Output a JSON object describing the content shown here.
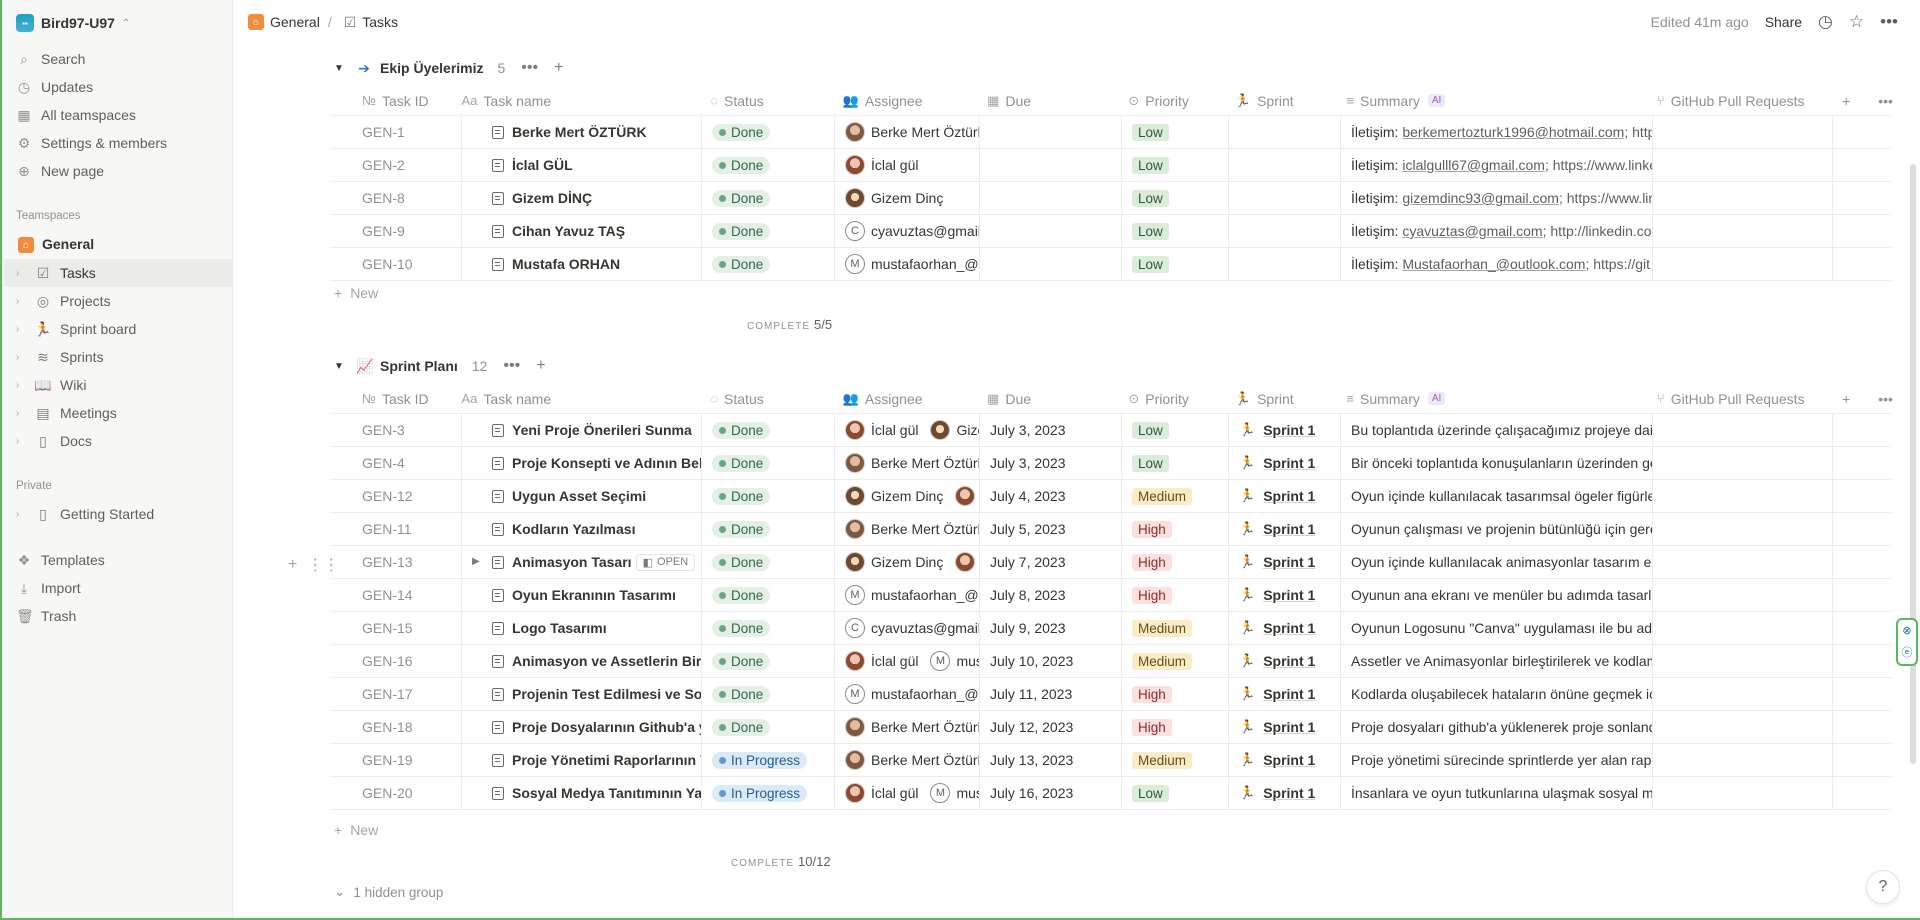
{
  "workspace": {
    "name": "Bird97-U97"
  },
  "sidebar": {
    "nav": [
      {
        "label": "Search",
        "icon": "search-icon"
      },
      {
        "label": "Updates",
        "icon": "clock-icon"
      },
      {
        "label": "All teamspaces",
        "icon": "grid-icon"
      },
      {
        "label": "Settings & members",
        "icon": "gear-icon"
      },
      {
        "label": "New page",
        "icon": "plus-circle-icon"
      }
    ],
    "teamspaces_label": "Teamspaces",
    "teamspace_home": "General",
    "teamspace_items": [
      {
        "label": "Tasks",
        "icon": "checkbox-icon"
      },
      {
        "label": "Projects",
        "icon": "target-icon"
      },
      {
        "label": "Sprint board",
        "icon": "runner-icon"
      },
      {
        "label": "Sprints",
        "icon": "database-icon"
      },
      {
        "label": "Wiki",
        "icon": "book-icon"
      },
      {
        "label": "Meetings",
        "icon": "calendar-icon"
      },
      {
        "label": "Docs",
        "icon": "document-icon"
      }
    ],
    "private_label": "Private",
    "private_items": [
      {
        "label": "Getting Started"
      }
    ],
    "bottom": [
      {
        "label": "Templates",
        "icon": "templates-icon"
      },
      {
        "label": "Import",
        "icon": "import-icon"
      },
      {
        "label": "Trash",
        "icon": "trash-icon"
      }
    ]
  },
  "topbar": {
    "crumb1": "General",
    "crumb_sep": "/",
    "crumb2": "Tasks",
    "edited": "Edited 41m ago",
    "share": "Share"
  },
  "columns": {
    "id": "Task ID",
    "name": "Task name",
    "status": "Status",
    "assignee": "Assignee",
    "due": "Due",
    "priority": "Priority",
    "sprint": "Sprint",
    "summary": "Summary",
    "ai": "AI",
    "github": "GitHub Pull Requests"
  },
  "group1": {
    "title": "Ekip Üyelerimiz",
    "count": "5",
    "new_label": "New",
    "complete_label": "COMPLETE",
    "complete_value": "5/5",
    "rows": [
      {
        "id": "GEN-1",
        "name": "Berke Mert ÖZTÜRK",
        "status": "Done",
        "assignee": "Berke Mert Öztürk",
        "priority": "Low",
        "summary_prefix": "İletişim: ",
        "summary_link": "berkemertozturk1996@hotmail.com",
        "summary_rest": "; http"
      },
      {
        "id": "GEN-2",
        "name": "İclal GÜL",
        "status": "Done",
        "assignee": "İclal gül",
        "priority": "Low",
        "summary_prefix": "İletişim: ",
        "summary_link": "iclalgulll67@gmail.com",
        "summary_rest": "; https://www.linke"
      },
      {
        "id": "GEN-8",
        "name": "Gizem DİNÇ",
        "status": "Done",
        "assignee": "Gizem Dinç",
        "priority": "Low",
        "summary_prefix": "İletişim: ",
        "summary_link": "gizemdinc93@gmail.com",
        "summary_rest": "; https://www.lir"
      },
      {
        "id": "GEN-9",
        "name": "Cihan Yavuz TAŞ",
        "status": "Done",
        "assignee": "cyavuztas@gmail.",
        "priority": "Low",
        "summary_prefix": "İletişim: ",
        "summary_link": "cyavuztas@gmail.com",
        "summary_rest": "; http://linkedin.cor"
      },
      {
        "id": "GEN-10",
        "name": "Mustafa ORHAN",
        "status": "Done",
        "assignee": "mustafaorhan_@o",
        "priority": "Low",
        "summary_prefix": "İletişim: ",
        "summary_link": "Mustafaorhan_@outlook.com",
        "summary_rest": "; https://git"
      }
    ]
  },
  "group2": {
    "title": "Sprint Planı",
    "count": "12",
    "new_label": "New",
    "complete_label": "COMPLETE",
    "complete_value": "10/12",
    "open_label": "OPEN",
    "rows": [
      {
        "id": "GEN-3",
        "name": "Yeni Proje Önerileri Sunma",
        "status": "Done",
        "a1": "İclal gül",
        "a2": "Gize",
        "due": "July 3, 2023",
        "priority": "Low",
        "sprint": "Sprint 1",
        "summary": "Bu toplantıda üzerinde çalışacağımız projeye dair"
      },
      {
        "id": "GEN-4",
        "name": "Proje Konsepti ve Adının Bel",
        "status": "Done",
        "a1": "Berke Mert Öztürk",
        "a2": "",
        "due": "July 3, 2023",
        "priority": "Low",
        "sprint": "Sprint 1",
        "summary": "Bir önceki toplantıda konuşulanların üzerinden ge"
      },
      {
        "id": "GEN-12",
        "name": "Uygun Asset Seçimi",
        "status": "Done",
        "a1": "Gizem Dinç",
        "a2": "İ",
        "due": "July 4, 2023",
        "priority": "Medium",
        "sprint": "Sprint 1",
        "summary": "Oyun içinde kullanılacak tasarımsal ögeler figürle"
      },
      {
        "id": "GEN-11",
        "name": "Kodların Yazılması",
        "status": "Done",
        "a1": "Berke Mert Öztürk",
        "a2": "",
        "due": "July 5, 2023",
        "priority": "High",
        "sprint": "Sprint 1",
        "summary": "Oyunun çalışması ve projenin bütünlüğü için gere"
      },
      {
        "id": "GEN-13",
        "name": "Animasyon Tasarı",
        "status": "Done",
        "a1": "Gizem Dinç",
        "a2": "İ",
        "due": "July 7, 2023",
        "priority": "High",
        "sprint": "Sprint 1",
        "summary": "Oyun içinde kullanılacak animasyonlar tasarım eki"
      },
      {
        "id": "GEN-14",
        "name": "Oyun Ekranının Tasarımı",
        "status": "Done",
        "a1": "mustafaorhan_@o",
        "a2": "",
        "due": "July 8, 2023",
        "priority": "High",
        "sprint": "Sprint 1",
        "summary": "Oyunun ana ekranı ve menüler bu adımda tasarla"
      },
      {
        "id": "GEN-15",
        "name": "Logo Tasarımı",
        "status": "Done",
        "a1": "cyavuztas@gmail.",
        "a2": "",
        "due": "July 9, 2023",
        "priority": "Medium",
        "sprint": "Sprint 1",
        "summary": "Oyunun Logosunu \"Canva\" uygulaması ile bu adır"
      },
      {
        "id": "GEN-16",
        "name": "Animasyon ve Assetlerin Birl",
        "status": "Done",
        "a1": "İclal gül",
        "a2": "mus",
        "due": "July 10, 2023",
        "priority": "Medium",
        "sprint": "Sprint 1",
        "summary": "Assetler ve Animasyonlar birleştirilerek ve kodlam"
      },
      {
        "id": "GEN-17",
        "name": "Projenin Test Edilmesi ve Sor",
        "status": "Done",
        "a1": "mustafaorhan_@o",
        "a2": "",
        "due": "July 11, 2023",
        "priority": "High",
        "sprint": "Sprint 1",
        "summary": "Kodlarda oluşabilecek hataların önüne geçmek içi"
      },
      {
        "id": "GEN-18",
        "name": "Proje Dosyalarının Github'a y",
        "status": "Done",
        "a1": "Berke Mert Öztürk",
        "a2": "",
        "due": "July 12, 2023",
        "priority": "High",
        "sprint": "Sprint 1",
        "summary": "Proje dosyaları github'a yüklenerek proje sonland"
      },
      {
        "id": "GEN-19",
        "name": "Proje Yönetimi Raporlarının Y",
        "status": "In Progress",
        "a1": "Berke Mert Öztürk",
        "a2": "",
        "due": "July 13, 2023",
        "priority": "Medium",
        "sprint": "Sprint 1",
        "summary": "Proje yönetimi sürecinde sprintlerde yer alan rapc"
      },
      {
        "id": "GEN-20",
        "name": "Sosyal Medya Tanıtımının Ya",
        "status": "In Progress",
        "a1": "İclal gül",
        "a2": "mus",
        "due": "July 16, 2023",
        "priority": "Low",
        "sprint": "Sprint 1",
        "summary": "İnsanlara ve oyun tutkunlarına ulaşmak sosyal me"
      }
    ]
  },
  "hidden_group": "1 hidden group",
  "help": "?"
}
